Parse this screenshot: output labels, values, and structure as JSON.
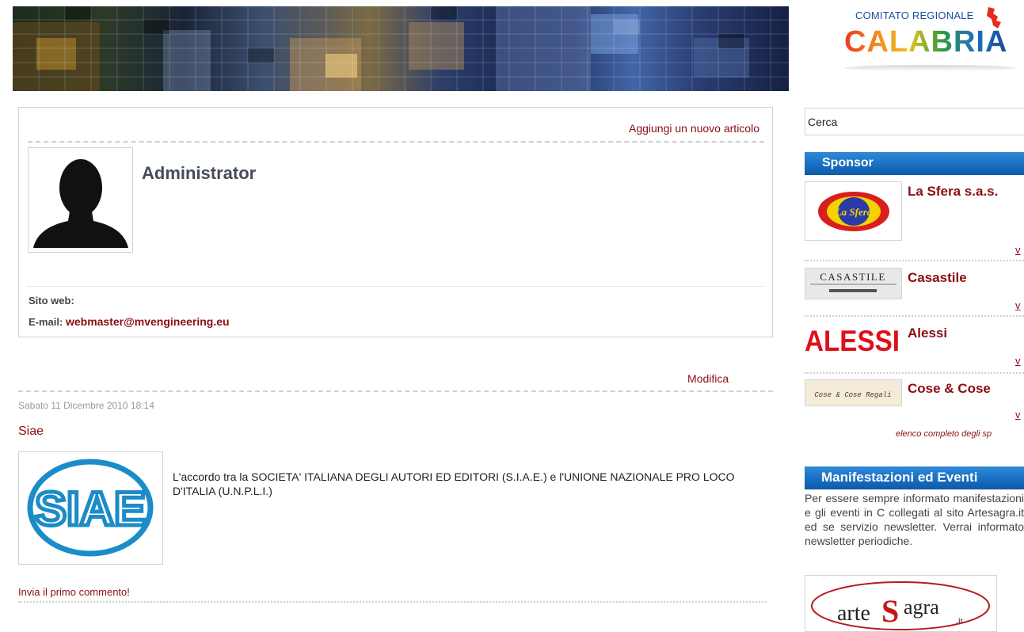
{
  "header": {
    "logo_top": "COMITATO REGIONALE",
    "logo_main": "CALABRIA"
  },
  "profile": {
    "add_article": "Aggiungi un nuovo articolo",
    "name": "Administrator",
    "site_label": "Sito web:",
    "email_label": "E-mail:",
    "email": "webmaster@mvengineering.eu"
  },
  "article": {
    "edit": "Modifica",
    "date": "Sabato 11 Dicembre 2010 18:14",
    "title": "Siae",
    "text": "L'accordo tra la SOCIETA' ITALIANA DEGLI AUTORI ED EDITORI (S.I.A.E.) e l'UNIONE NAZIONALE PRO LOCO D'ITALIA (U.N.P.L.I.)",
    "image_logo": "SIAE",
    "first_comment": "Invia il primo commento!"
  },
  "sidebar": {
    "search_value": "Cerca",
    "sponsor_heading": "Sponsor",
    "sponsors": [
      {
        "name": "La Sfera s.a.s.",
        "logo": "La Sfera",
        "more": "v"
      },
      {
        "name": "Casastile",
        "logo": "CASASTILE",
        "more": "v"
      },
      {
        "name": "Alessi",
        "logo": "ALESSI",
        "more": "v"
      },
      {
        "name": "Cose & Cose",
        "logo": "Cose & Cose Regali",
        "more": "v"
      }
    ],
    "all_sponsors": "elenco completo degli sp",
    "events_heading": "Manifestazioni ed Eventi",
    "events_text": "Per essere sempre informato manifestazioni e gli eventi in C collegati al sito Artesagra.it ed se servizio newsletter. Verrai informato newsletter periodiche.",
    "artesagra_logo_a": "arte",
    "artesagra_logo_s": "S",
    "artesagra_logo_b": "agra",
    "artesagra_logo_it": ".it"
  },
  "colors": {
    "link": "#8b0d12",
    "sidebar_heading": "#176cc0"
  }
}
